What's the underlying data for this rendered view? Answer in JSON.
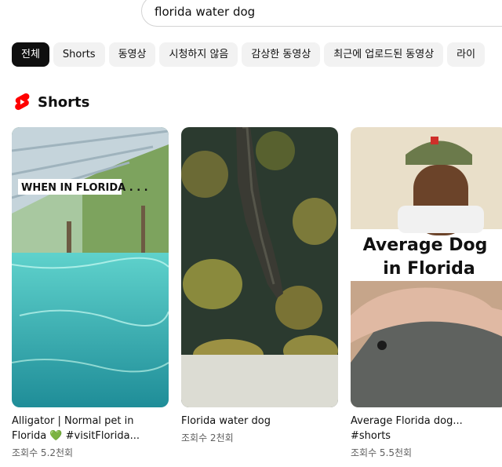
{
  "search": {
    "query": "florida water dog"
  },
  "chips": [
    {
      "label": "전체",
      "active": true
    },
    {
      "label": "Shorts",
      "active": false
    },
    {
      "label": "동영상",
      "active": false
    },
    {
      "label": "시청하지 않음",
      "active": false
    },
    {
      "label": "감상한 동영상",
      "active": false
    },
    {
      "label": "최근에 업로드된 동영상",
      "active": false
    },
    {
      "label": "라이",
      "active": false
    }
  ],
  "shorts_section": {
    "title": "Shorts",
    "icon": "shorts-logo-icon",
    "accent_color": "#ff0000",
    "cards": [
      {
        "title_line1": "Alligator | Normal pet in",
        "title_line2": "Florida 💚 #visitFlorida...",
        "views": "조회수 5.2천회",
        "overlay_text": "WHEN IN FLORIDA . . ."
      },
      {
        "title_line1": "Florida water dog",
        "title_line2": "",
        "views": "조회수 2천회"
      },
      {
        "title_line1": "Average Florida dog...",
        "title_line2": "#shorts",
        "views": "조회수 5.5천회",
        "overlay_line1": "Average Dog",
        "overlay_line2": "in Florida"
      }
    ]
  }
}
